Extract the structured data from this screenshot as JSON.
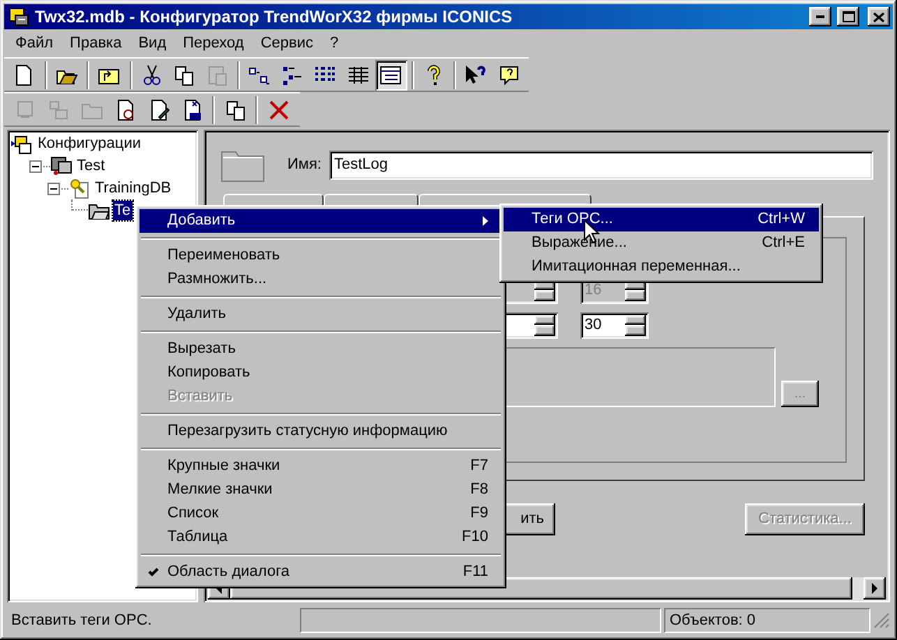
{
  "window": {
    "title": "Twx32.mdb - Конфигуратор TrendWorX32 фирмы ICONICS"
  },
  "menu_bar": [
    "Файл",
    "Правка",
    "Вид",
    "Переход",
    "Сервис",
    "?"
  ],
  "toolbar_1": [
    {
      "kind": "new",
      "disabled": false,
      "pressed": false
    },
    {
      "kind": "sep"
    },
    {
      "kind": "open",
      "disabled": false,
      "pressed": false
    },
    {
      "kind": "sep"
    },
    {
      "kind": "up",
      "disabled": false,
      "pressed": false
    },
    {
      "kind": "sep"
    },
    {
      "kind": "cut",
      "disabled": false,
      "pressed": false
    },
    {
      "kind": "copy",
      "disabled": false,
      "pressed": false
    },
    {
      "kind": "paste",
      "disabled": true,
      "pressed": false
    },
    {
      "kind": "sep"
    },
    {
      "kind": "large",
      "disabled": false,
      "pressed": false
    },
    {
      "kind": "small",
      "disabled": false,
      "pressed": false
    },
    {
      "kind": "list",
      "disabled": false,
      "pressed": false
    },
    {
      "kind": "details",
      "disabled": false,
      "pressed": false
    },
    {
      "kind": "pane",
      "disabled": false,
      "pressed": true
    },
    {
      "kind": "sep"
    },
    {
      "kind": "help",
      "disabled": false,
      "pressed": false
    },
    {
      "kind": "sep"
    },
    {
      "kind": "whatsthis",
      "disabled": false,
      "pressed": false
    },
    {
      "kind": "helpbubble",
      "disabled": false,
      "pressed": false
    }
  ],
  "toolbar_2": [
    {
      "kind": "server",
      "disabled": true,
      "pressed": false
    },
    {
      "kind": "db",
      "disabled": true,
      "pressed": false
    },
    {
      "kind": "folder",
      "disabled": true,
      "pressed": false
    },
    {
      "kind": "docsearch",
      "disabled": false,
      "pressed": false
    },
    {
      "kind": "docedit",
      "disabled": false,
      "pressed": false
    },
    {
      "kind": "docx",
      "disabled": false,
      "pressed": false
    },
    {
      "kind": "sep"
    },
    {
      "kind": "copy",
      "disabled": false,
      "pressed": false
    },
    {
      "kind": "sep"
    },
    {
      "kind": "delete",
      "disabled": false,
      "pressed": false
    }
  ],
  "tree": [
    {
      "label": "Конфигурации",
      "kind": "root",
      "selected": false,
      "children": [
        {
          "label": "Test",
          "kind": "computer",
          "selected": false,
          "expanded": true,
          "children": [
            {
              "label": "TrainingDB",
              "kind": "database",
              "selected": false,
              "expanded": true,
              "children": [
                {
                  "label": "Te",
                  "kind": "folder",
                  "selected": true
                }
              ]
            }
          ]
        }
      ]
    }
  ],
  "details": {
    "name_label": "Имя:",
    "name_value": "TestLog",
    "spin_fields": [
      {
        "value": "16",
        "disabled": true
      },
      {
        "value": "30",
        "disabled": false
      }
    ],
    "browse_button": {
      "label": "...",
      "disabled": true
    },
    "buttons": [
      {
        "label": "ить",
        "disabled": false
      },
      {
        "label": "Статистика...",
        "disabled": true
      }
    ]
  },
  "context_menu": [
    {
      "kind": "item",
      "label": "Добавить",
      "selected": true,
      "disabled": false,
      "checked": false,
      "submenu": true
    },
    {
      "kind": "separator"
    },
    {
      "kind": "item",
      "label": "Переименовать",
      "selected": false,
      "disabled": false,
      "checked": false
    },
    {
      "kind": "item",
      "label": "Размножить...",
      "selected": false,
      "disabled": false,
      "checked": false
    },
    {
      "kind": "separator"
    },
    {
      "kind": "item",
      "label": "Удалить",
      "selected": false,
      "disabled": false,
      "checked": false
    },
    {
      "kind": "separator"
    },
    {
      "kind": "item",
      "label": "Вырезать",
      "selected": false,
      "disabled": false,
      "checked": false
    },
    {
      "kind": "item",
      "label": "Копировать",
      "selected": false,
      "disabled": false,
      "checked": false
    },
    {
      "kind": "item",
      "label": "Вставить",
      "selected": false,
      "disabled": true,
      "checked": false
    },
    {
      "kind": "separator"
    },
    {
      "kind": "item",
      "label": "Перезагрузить статусную информацию",
      "selected": false,
      "disabled": false,
      "checked": false
    },
    {
      "kind": "separator"
    },
    {
      "kind": "item",
      "label": "Крупные значки",
      "shortcut": "F7",
      "selected": false,
      "disabled": false,
      "checked": false
    },
    {
      "kind": "item",
      "label": "Мелкие значки",
      "shortcut": "F8",
      "selected": false,
      "disabled": false,
      "checked": false
    },
    {
      "kind": "item",
      "label": "Список",
      "shortcut": "F9",
      "selected": false,
      "disabled": false,
      "checked": false
    },
    {
      "kind": "item",
      "label": "Таблица",
      "shortcut": "F10",
      "selected": false,
      "disabled": false,
      "checked": false
    },
    {
      "kind": "separator"
    },
    {
      "kind": "item",
      "label": "Область диалога",
      "shortcut": "F11",
      "selected": false,
      "disabled": false,
      "checked": true
    }
  ],
  "submenu": [
    {
      "label": "Теги OPC...",
      "shortcut": "Ctrl+W",
      "selected": true
    },
    {
      "label": "Выражение...",
      "shortcut": "Ctrl+E",
      "selected": false
    },
    {
      "label": "Имитационная переменная...",
      "selected": false
    }
  ],
  "status_bar": {
    "message": "Вставить теги OPC.",
    "count": "Объектов: 0"
  }
}
